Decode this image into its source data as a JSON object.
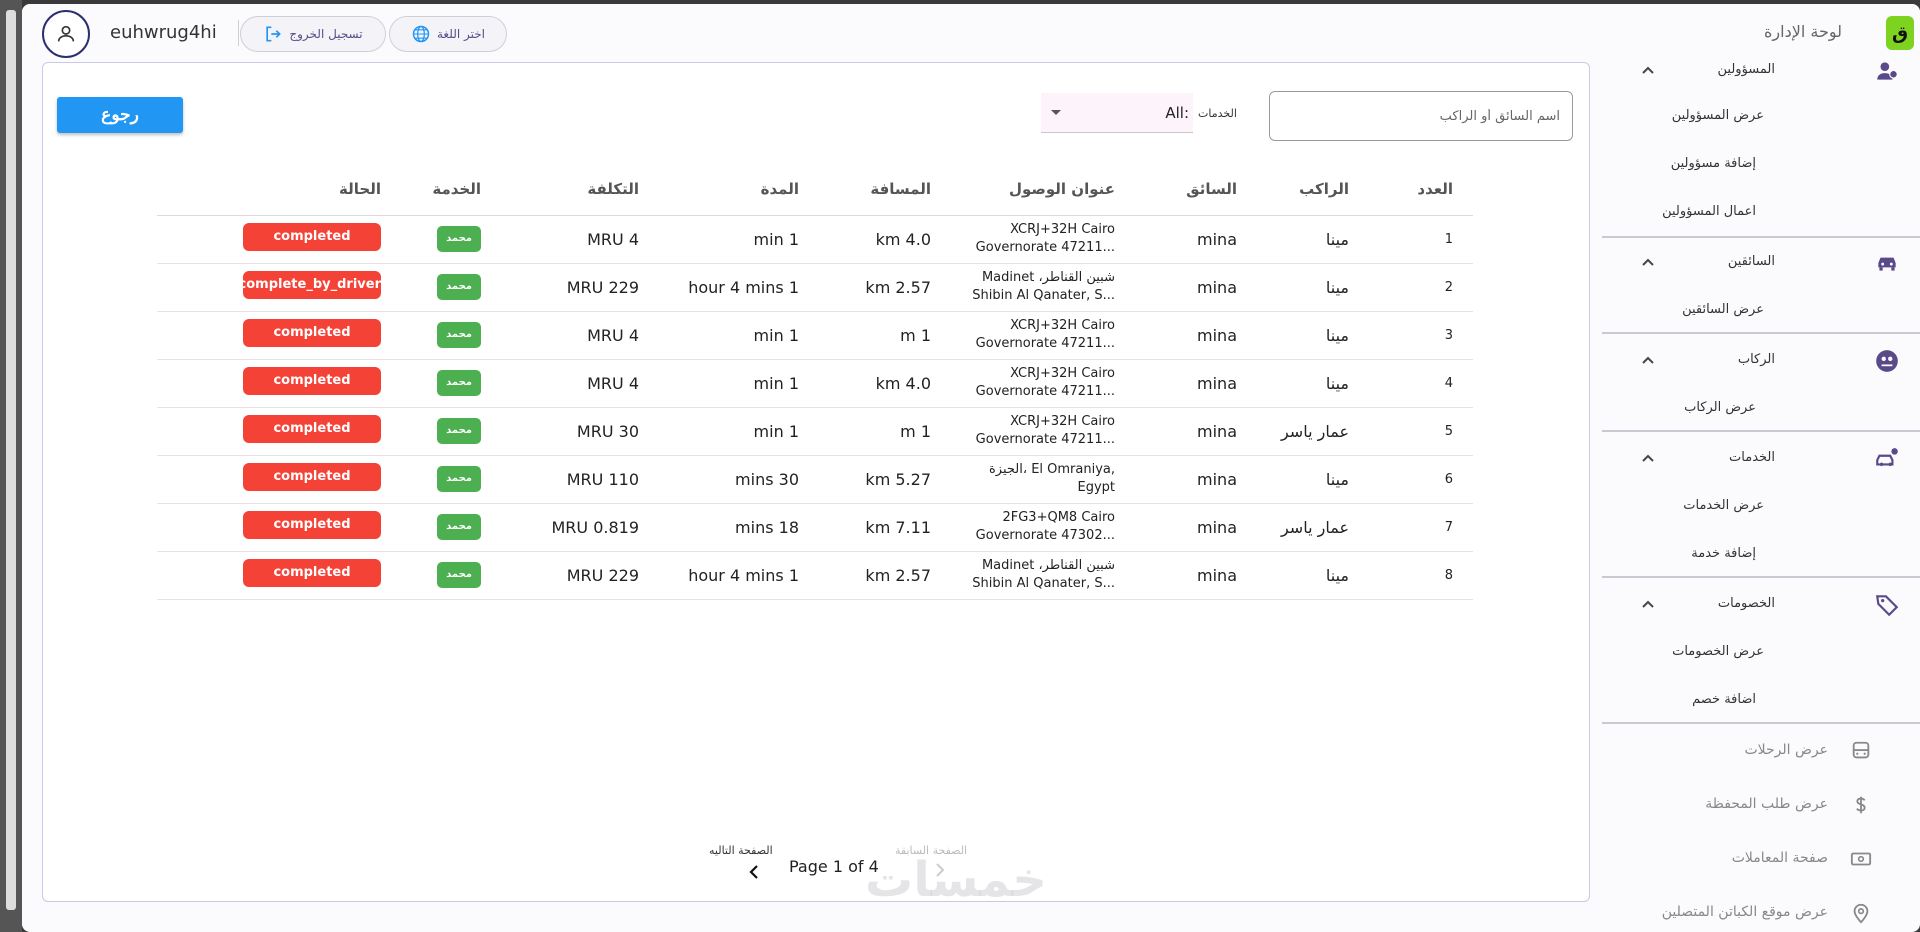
{
  "topbar": {
    "username": "euhwrug4hi",
    "logout_label": "تسجيل الخروج",
    "language_label": "اختر اللغة",
    "admin_title": "لوحة الإدارة",
    "logo_text": "ق"
  },
  "content": {
    "back_label": "رجوع",
    "search_placeholder": "اسم السائق أو الراكب",
    "filter_label": "الخدمات",
    "filter_value": "All:"
  },
  "table": {
    "headers": {
      "index": "العدد",
      "rider": "الراكب",
      "driver": "السائق",
      "destination": "عنوان الوصول",
      "distance": "المسافة",
      "duration": "المدة",
      "cost": "التكلفة",
      "service": "الخدمة",
      "status": "الحالة"
    },
    "rows": [
      {
        "index": "1",
        "rider": "مينا",
        "driver": "mina",
        "addr1": "XCRJ+32H  Cairo",
        "addr2": "Governorate 47211...",
        "distance": "4.0 km",
        "duration": "1 min",
        "cost": "4 MRU",
        "service": "محمد",
        "status": "completed"
      },
      {
        "index": "2",
        "rider": "مينا",
        "driver": "mina",
        "addr1": "Madinet ،شبين القناطر",
        "addr2": "Shibin Al Qanater, S...",
        "distance": "2.57 km",
        "duration": "1 hour 4 mins",
        "cost": "229 MRU",
        "service": "محمد",
        "status": "complete_by_driver"
      },
      {
        "index": "3",
        "rider": "مينا",
        "driver": "mina",
        "addr1": "XCRJ+32H  Cairo",
        "addr2": "Governorate 47211...",
        "distance": "1 m",
        "duration": "1 min",
        "cost": "4 MRU",
        "service": "محمد",
        "status": "completed"
      },
      {
        "index": "4",
        "rider": "مينا",
        "driver": "mina",
        "addr1": "XCRJ+32H  Cairo",
        "addr2": "Governorate 47211...",
        "distance": "4.0 km",
        "duration": "1 min",
        "cost": "4 MRU",
        "service": "محمد",
        "status": "completed"
      },
      {
        "index": "5",
        "rider": "عمار ياسر",
        "driver": "mina",
        "addr1": "XCRJ+32H  Cairo",
        "addr2": "Governorate 47211...",
        "distance": "1 m",
        "duration": "1 min",
        "cost": "30 MRU",
        "service": "محمد",
        "status": "completed"
      },
      {
        "index": "6",
        "rider": "مينا",
        "driver": "mina",
        "addr1": "الجيزة، El Omraniya,",
        "addr2": "Egypt",
        "distance": "5.27 km",
        "duration": "30 mins",
        "cost": "110 MRU",
        "service": "محمد",
        "status": "completed"
      },
      {
        "index": "7",
        "rider": "عمار ياسر",
        "driver": "mina",
        "addr1": "2FG3+QM8  Cairo",
        "addr2": "Governorate 47302...",
        "distance": "7.11 km",
        "duration": "18 mins",
        "cost": "0.819 MRU",
        "service": "محمد",
        "status": "completed"
      },
      {
        "index": "8",
        "rider": "مينا",
        "driver": "mina",
        "addr1": "Madinet ،شبين القناطر",
        "addr2": "Shibin Al Qanater, S...",
        "distance": "2.57 km",
        "duration": "1 hour 4 mins",
        "cost": "229 MRU",
        "service": "محمد",
        "status": "completed"
      }
    ]
  },
  "pagination": {
    "prev_label": "الصفحة السابقة",
    "next_label": "الصفحة التاليه",
    "page_text": "Page 1 of 4"
  },
  "sidebar": {
    "admins": {
      "label": "المسؤولين",
      "items": [
        "عرض المسؤولين",
        "إضافة مسؤولين",
        "اعمال المسؤولين"
      ]
    },
    "drivers": {
      "label": "السائقين",
      "items": [
        "عرض السائقين"
      ]
    },
    "riders": {
      "label": "الركاب",
      "items": [
        "عرض الركاب"
      ]
    },
    "services": {
      "label": "الخدمات",
      "items": [
        "عرض الخدمات",
        "إضافة خدمة"
      ]
    },
    "discounts": {
      "label": "الخصومات",
      "items": [
        "عرض الخصومات",
        "اضافة خصم"
      ]
    },
    "bottom": [
      "عرض الرحلات",
      "عرض طلب المحفظة",
      "صفحة المعاملات",
      "عرض موقع الكباتن المتصلين"
    ]
  },
  "watermark": "خمسات",
  "colors": {
    "primary_blue": "#2196f3",
    "status_red": "#f44336",
    "service_green": "#4caf50",
    "accent_purple": "#5a4a8a",
    "logo_green": "#7ed321"
  }
}
